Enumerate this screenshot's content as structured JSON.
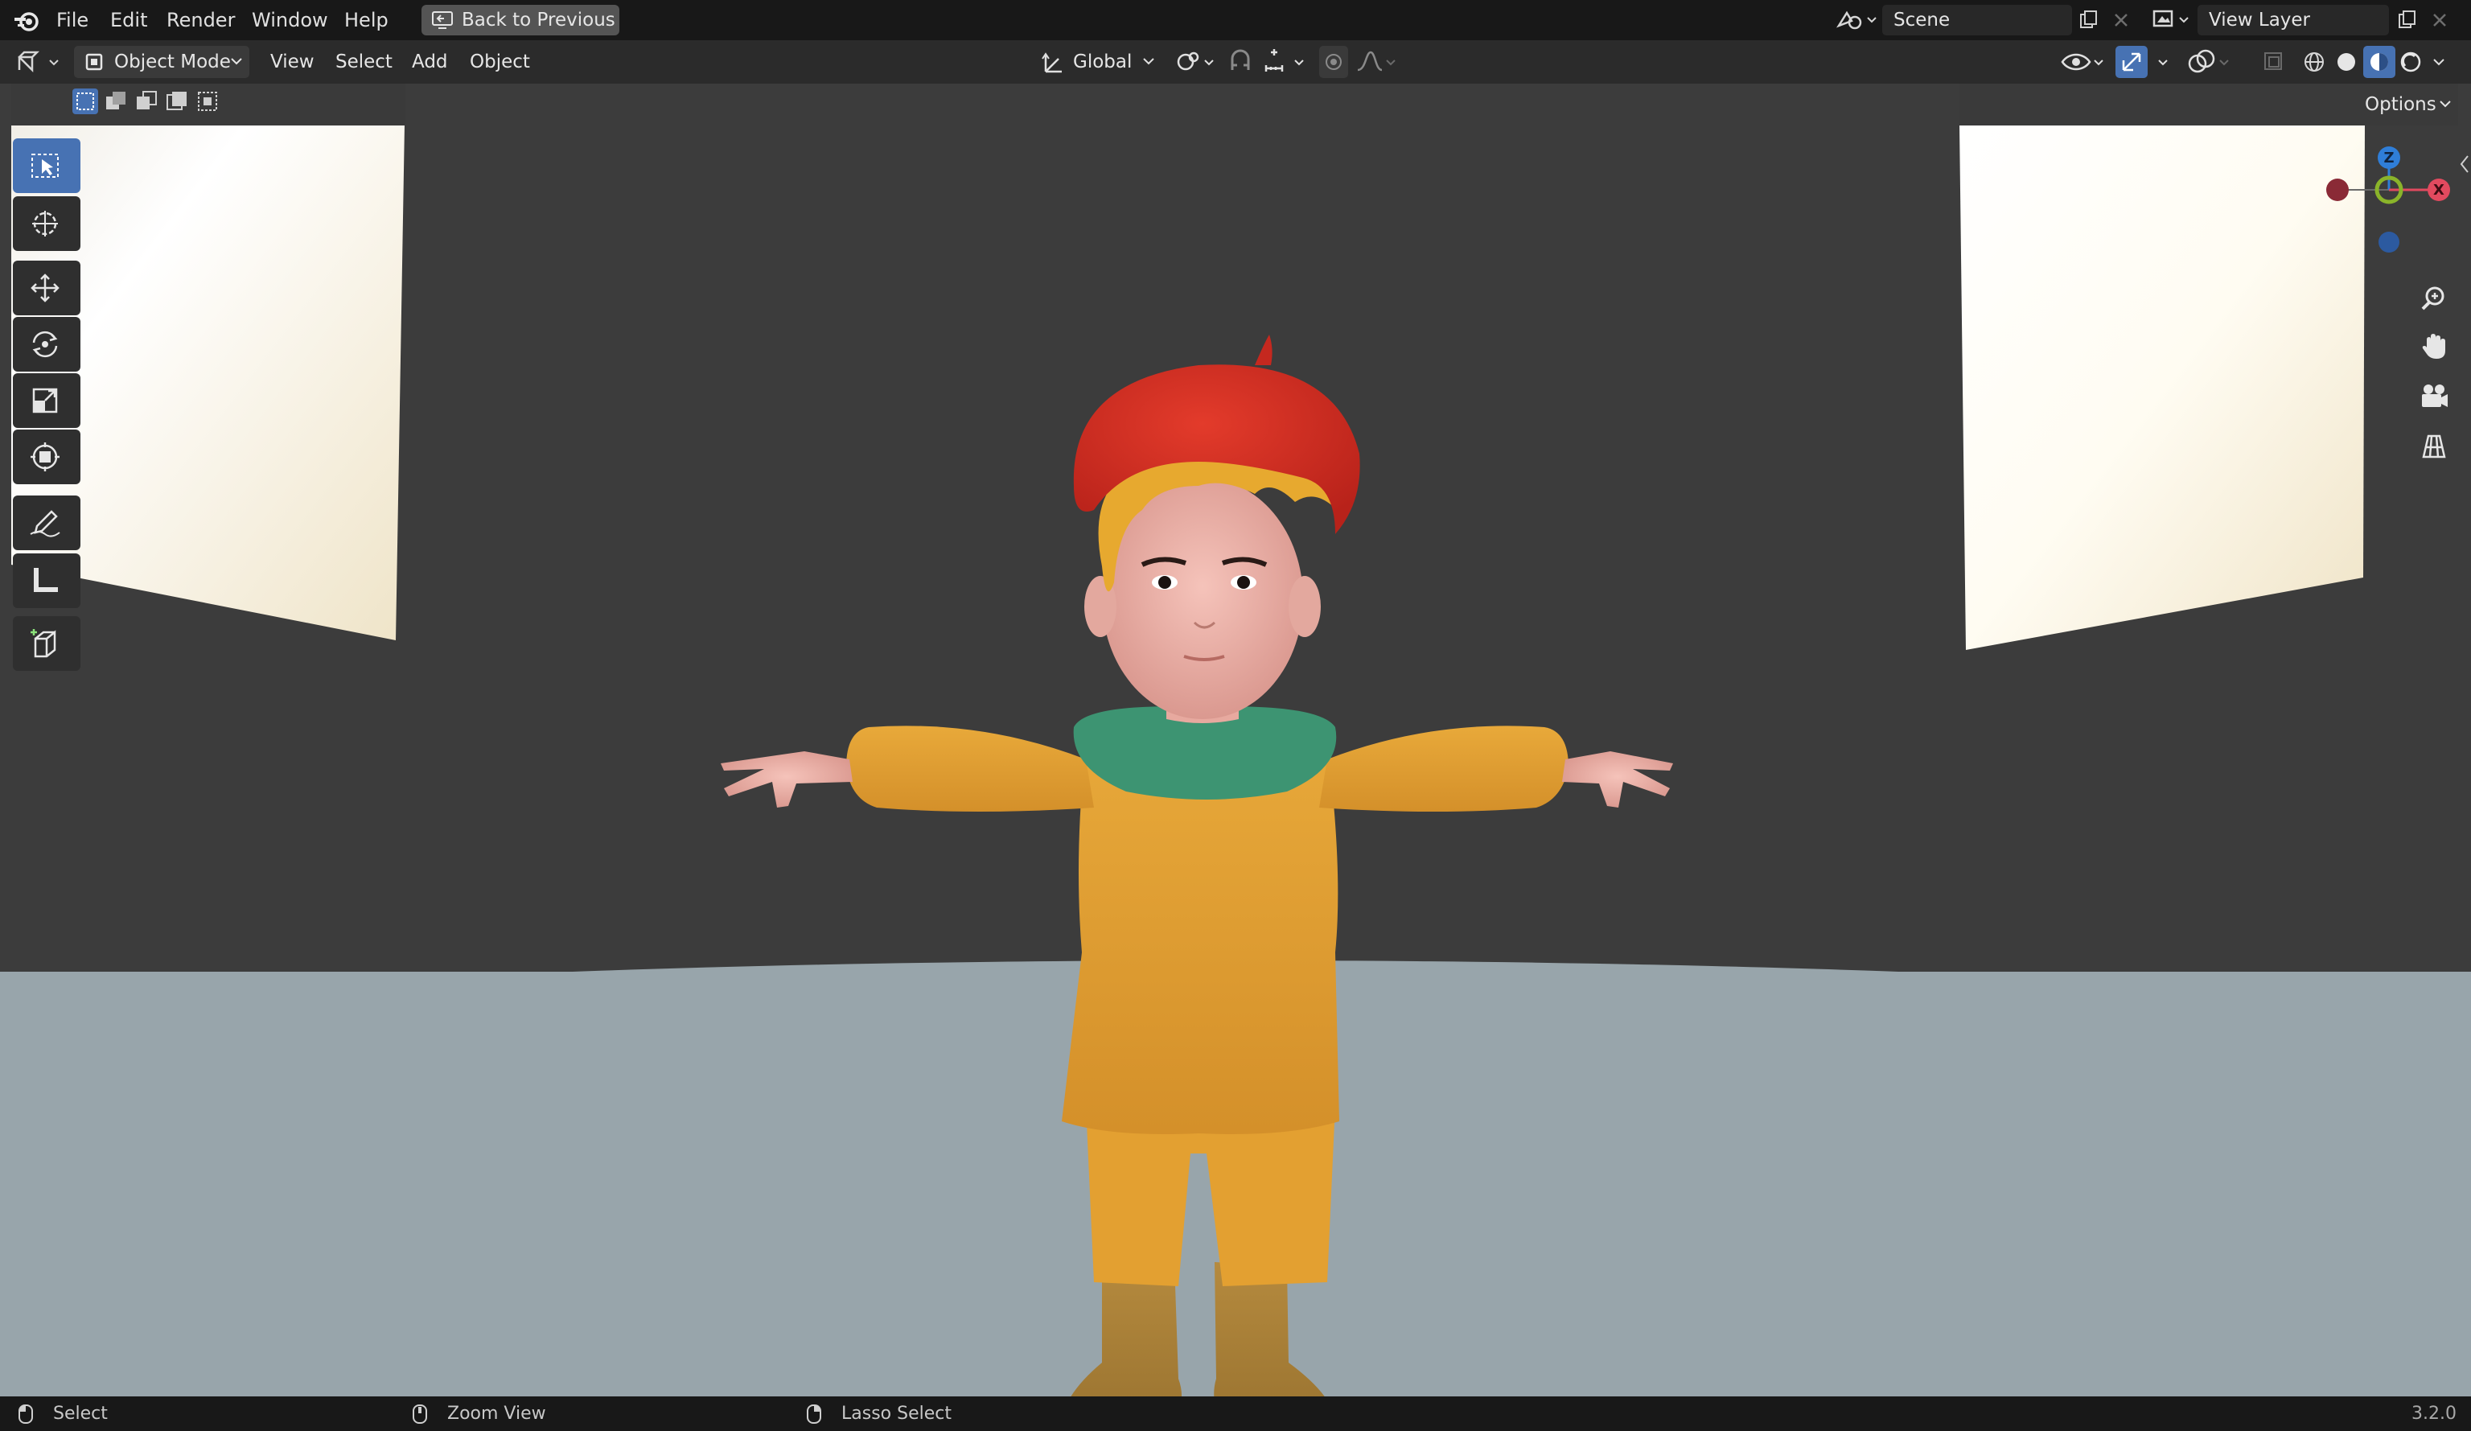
{
  "menubar": {
    "items": [
      "File",
      "Edit",
      "Render",
      "Window",
      "Help"
    ],
    "back_button": "Back to Previous",
    "scene": "Scene",
    "view_layer": "View Layer"
  },
  "header": {
    "mode": "Object Mode",
    "menus": [
      "View",
      "Select",
      "Add",
      "Object"
    ],
    "transform_orientation": "Global",
    "options_label": "Options"
  },
  "gizmo": {
    "z": "Z",
    "x": "X"
  },
  "toolbar": {
    "tools": [
      "select-box",
      "cursor",
      "move",
      "rotate",
      "scale",
      "transform",
      "annotate",
      "measure",
      "add-cube"
    ],
    "active": "select-box"
  },
  "statusbar": {
    "items": [
      "Select",
      "Zoom View",
      "Lasso Select"
    ],
    "version": "3.2.0"
  },
  "colors": {
    "accent": "#4772b3",
    "axis_x": "#e24a5f",
    "axis_y": "#8ab42a",
    "axis_z": "#2f7ed8"
  }
}
